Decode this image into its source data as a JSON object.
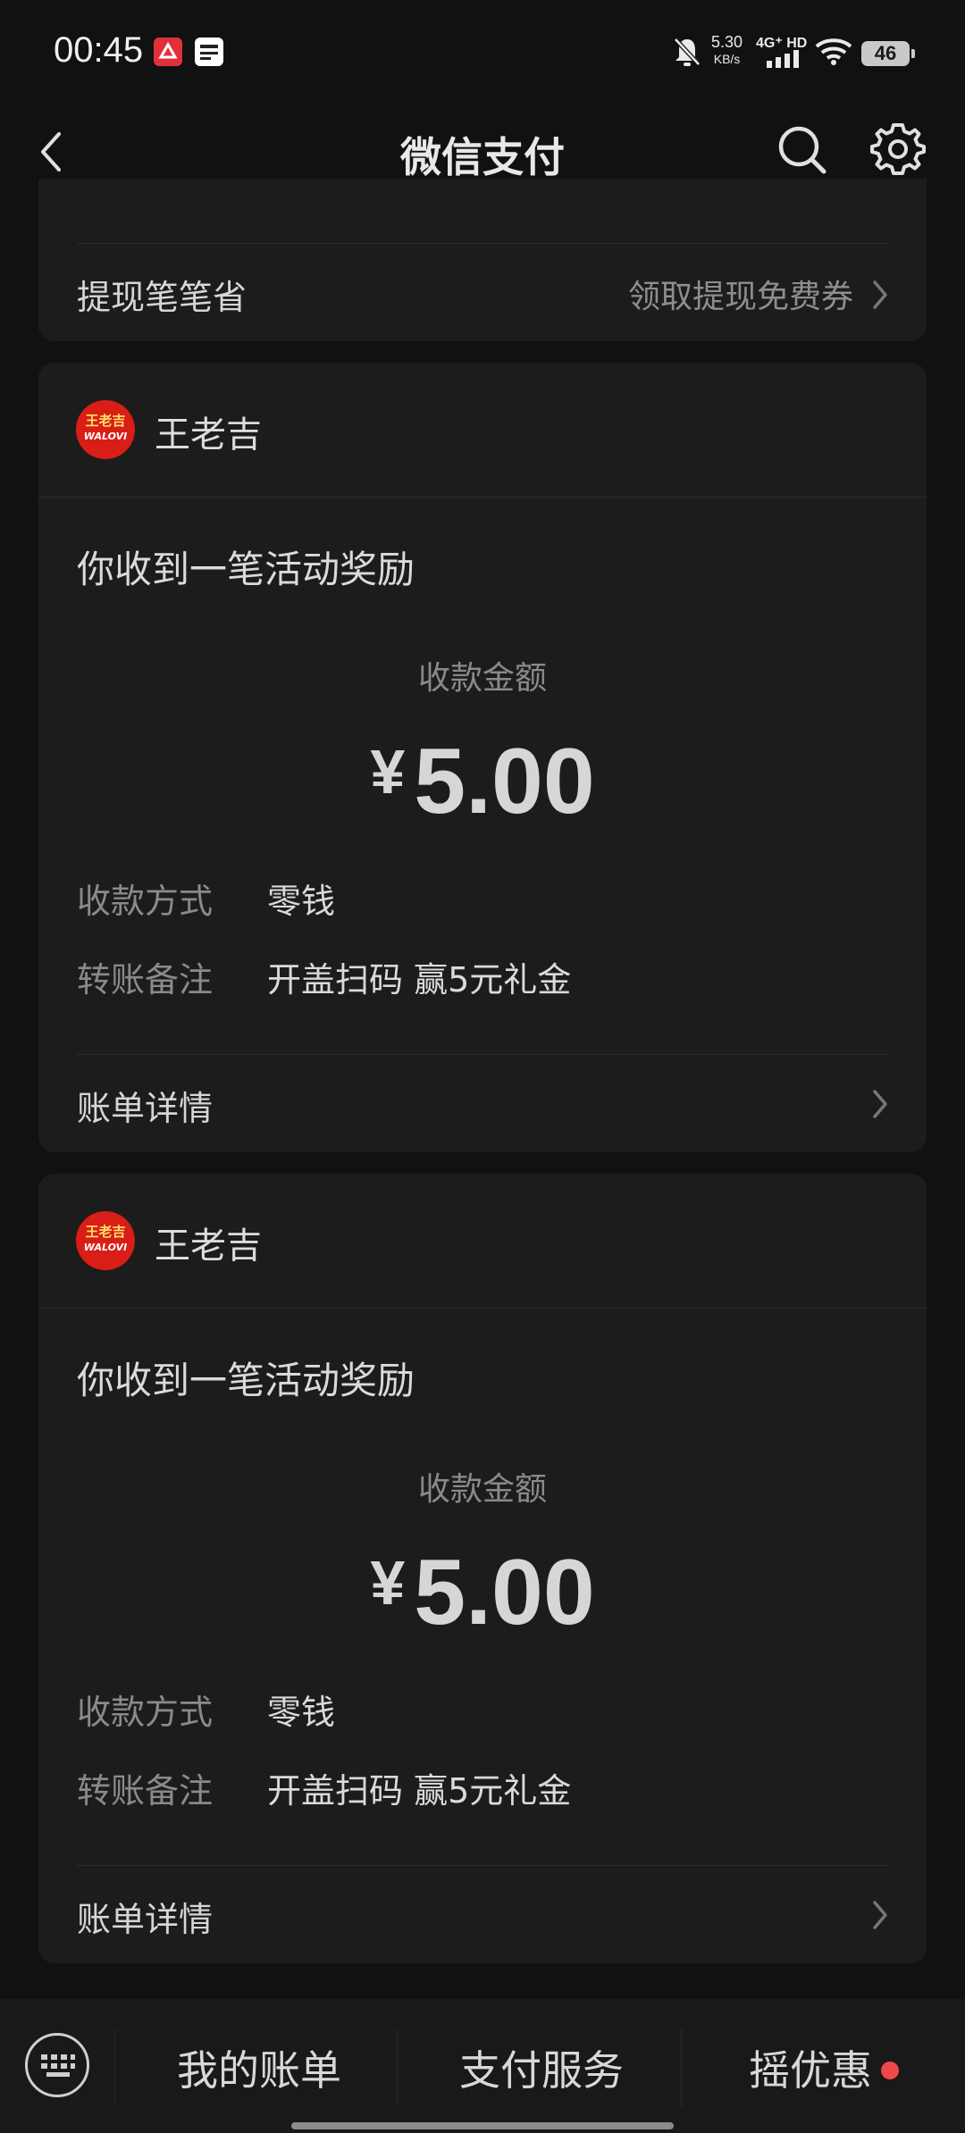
{
  "status_bar": {
    "time": "00:45",
    "net_speed_value": "5.30",
    "net_speed_unit": "KB/s",
    "network": "4G⁺ HD",
    "battery": "46"
  },
  "nav": {
    "title": "微信支付"
  },
  "top_card": {
    "label": "提现笔笔省",
    "action": "领取提现免费券"
  },
  "messages": [
    {
      "merchant": "王老吉",
      "logo_text": "王老吉",
      "logo_sub": "WALOVI",
      "headline": "你收到一笔活动奖励",
      "amount_label": "收款金额",
      "currency": "¥",
      "amount": "5.00",
      "method_label": "收款方式",
      "method_value": "零钱",
      "note_label": "转账备注",
      "note_value": "开盖扫码 赢5元礼金",
      "detail_label": "账单详情"
    },
    {
      "merchant": "王老吉",
      "logo_text": "王老吉",
      "logo_sub": "WALOVI",
      "headline": "你收到一笔活动奖励",
      "amount_label": "收款金额",
      "currency": "¥",
      "amount": "5.00",
      "method_label": "收款方式",
      "method_value": "零钱",
      "note_label": "转账备注",
      "note_value": "开盖扫码 赢5元礼金",
      "detail_label": "账单详情"
    }
  ],
  "bottom_bar": {
    "items": [
      "我的账单",
      "支付服务",
      "摇优惠"
    ]
  },
  "colors": {
    "background": "#111111",
    "card": "#1c1c1c",
    "red_dot": "#f04848",
    "logo_red": "#d81e16"
  }
}
